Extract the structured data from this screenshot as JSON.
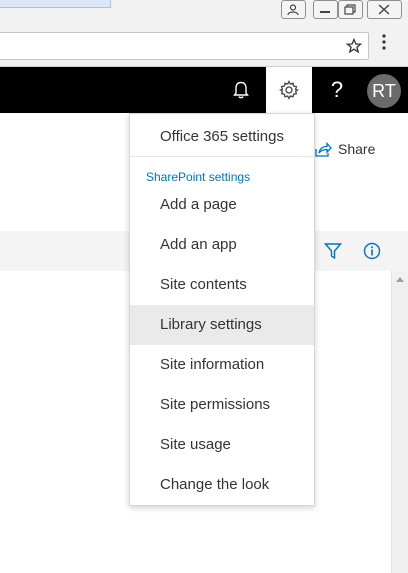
{
  "suitebar": {
    "avatar_initials": "RT",
    "help_label": "?"
  },
  "toolbar": {
    "share_label": "Share"
  },
  "settings_menu": {
    "office_label": "Office 365 settings",
    "section_label": "SharePoint settings",
    "items": [
      {
        "label": "Add a page"
      },
      {
        "label": "Add an app"
      },
      {
        "label": "Site contents"
      },
      {
        "label": "Library settings",
        "highlighted": true
      },
      {
        "label": "Site information"
      },
      {
        "label": "Site permissions"
      },
      {
        "label": "Site usage"
      },
      {
        "label": "Change the look"
      }
    ]
  },
  "colors": {
    "suite_bar": "#000000",
    "accent": "#0072c6",
    "menu_hover": "#eaeaea"
  }
}
